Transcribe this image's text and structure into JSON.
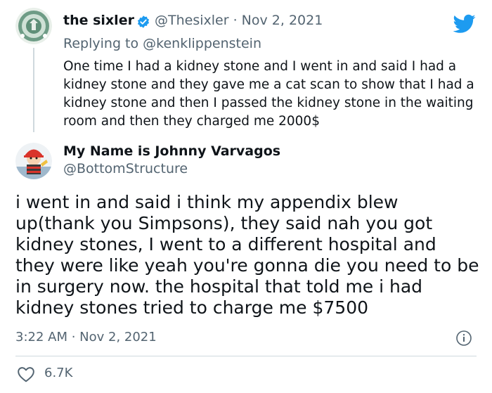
{
  "parent_tweet": {
    "display_name": "the sixler",
    "handle_and_date": "@Thesixler · Nov 2, 2021",
    "replying_prefix": "Replying to ",
    "replying_to": "@kenklippenstein",
    "text": "One time I had a kidney stone and I went in and said I had a kidney stone and they gave me a cat scan to show that I had a kidney stone and then I passed the kidney stone in the waiting room and then they charged me 2000$"
  },
  "main_tweet": {
    "display_name": "My Name is Johnny Varvagos",
    "handle": "@BottomStructure",
    "text": "i went in and said i think my appendix blew up(thank you Simpsons), they said nah you got kidney stones, I went to a different hospital and they were like yeah you're gonna die you need to be in surgery now. the hospital that told me i had kidney stones tried to charge me $7500",
    "timestamp": "3:22 AM · Nov 2, 2021",
    "like_count": "6.7K"
  },
  "icons": {
    "brand": "twitter-bird-icon",
    "verified": "verified-badge-icon",
    "info": "info-icon",
    "like": "heart-icon"
  },
  "colors": {
    "brand_blue": "#1d9bf0",
    "text_primary": "#0f1419",
    "text_secondary": "#536471",
    "divider": "#cfd9de"
  }
}
